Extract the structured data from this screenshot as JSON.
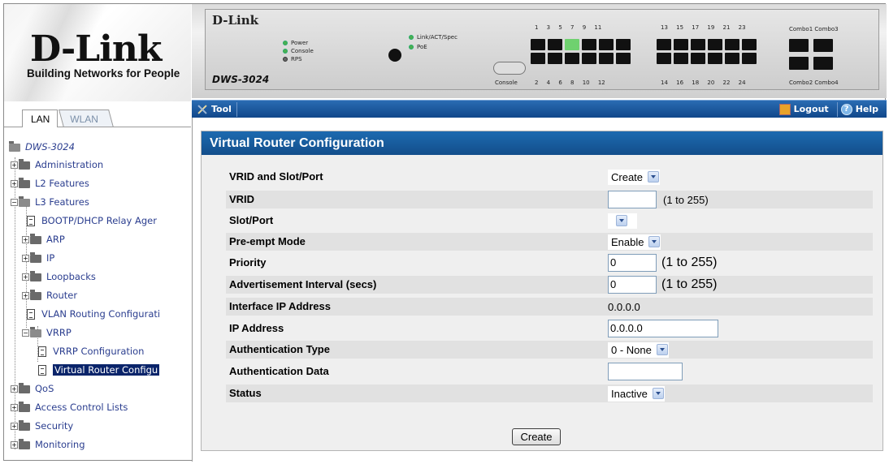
{
  "logo": {
    "brand": "D-Link",
    "tagline": "Building Networks for People"
  },
  "tabs": [
    {
      "label": "LAN"
    },
    {
      "label": "WLAN"
    }
  ],
  "device": {
    "brand": "D-Link",
    "model": "DWS-3024",
    "leds": [
      "Power",
      "Console",
      "RPS",
      "Link/ACT/Spec",
      "PoE"
    ],
    "console_label": "Console",
    "port_numbers_top_a": "1 3 5 7 9 11",
    "port_numbers_top_b": "13 15 17 19 21 23",
    "port_numbers_bottom_a": "2 4 6 8 10 12",
    "port_numbers_bottom_b": "14 16 18 20 22 24",
    "combo_top": "Combo1 Combo3",
    "combo_bottom": "Combo2 Combo4"
  },
  "toolbar": {
    "tool": "Tool",
    "logout": "Logout",
    "help": "Help"
  },
  "tree": {
    "root": "DWS-3024",
    "items": [
      "Administration",
      "L2 Features",
      "L3 Features",
      "BOOTP/DHCP Relay Ager",
      "ARP",
      "IP",
      "Loopbacks",
      "Router",
      "VLAN Routing Configurati",
      "VRRP",
      "VRRP Configuration",
      "Virtual Router Configu",
      "QoS",
      "Access Control Lists",
      "Security",
      "Monitoring"
    ]
  },
  "panel": {
    "title": "Virtual Router Configuration",
    "rows": [
      {
        "label": "VRID and Slot/Port",
        "select": "Create"
      },
      {
        "label": "VRID",
        "input": "",
        "hint": "(1 to 255)"
      },
      {
        "label": "Slot/Port",
        "select": ""
      },
      {
        "label": "Pre-empt Mode",
        "select": "Enable"
      },
      {
        "label": "Priority",
        "input": "0",
        "hint": "(1 to 255)"
      },
      {
        "label": "Advertisement Interval (secs)",
        "input": "0",
        "hint": "(1 to 255)"
      },
      {
        "label": "Interface IP Address",
        "text": "0.0.0.0"
      },
      {
        "label": "IP Address",
        "input": "0.0.0.0"
      },
      {
        "label": "Authentication Type",
        "select": "0 - None"
      },
      {
        "label": "Authentication Data",
        "input": ""
      },
      {
        "label": "Status",
        "select": "Inactive"
      }
    ],
    "button": "Create"
  }
}
